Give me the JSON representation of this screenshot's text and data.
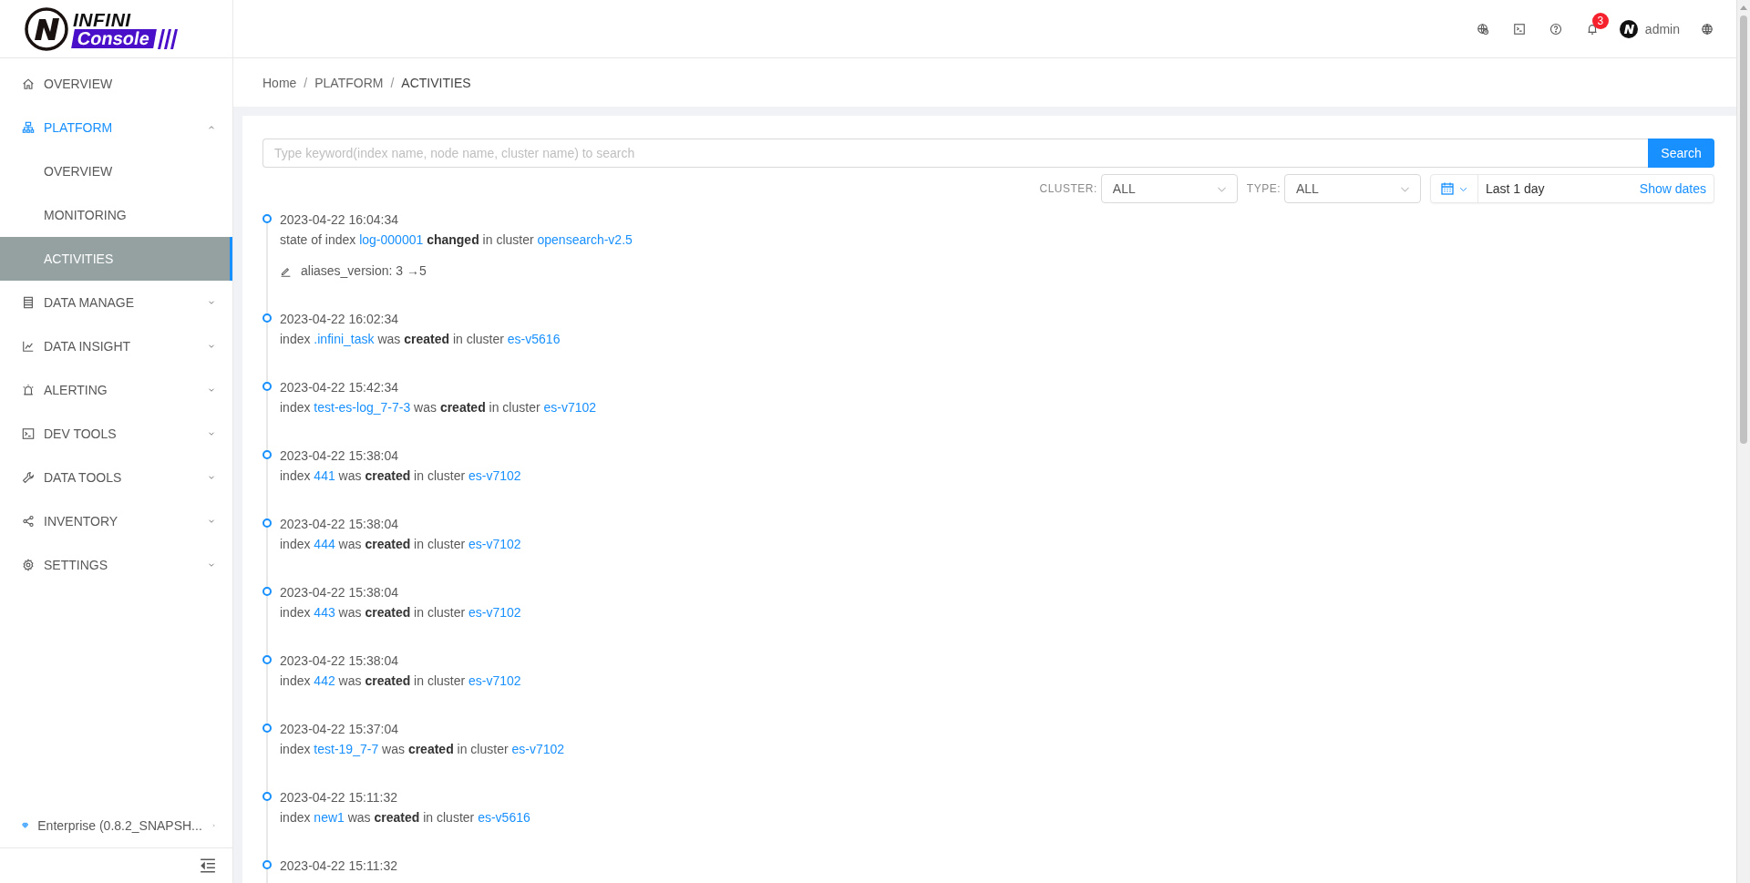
{
  "logo": {
    "top": "INFINI",
    "bottom": "Console"
  },
  "header": {
    "notifications": "3",
    "user": "admin"
  },
  "sidebar": {
    "items": [
      {
        "label": "OVERVIEW"
      },
      {
        "label": "PLATFORM",
        "expanded": true,
        "children": [
          {
            "label": "OVERVIEW",
            "selected": false
          },
          {
            "label": "MONITORING",
            "selected": false
          },
          {
            "label": "ACTIVITIES",
            "selected": true
          }
        ]
      },
      {
        "label": "DATA MANAGE",
        "expanded": false
      },
      {
        "label": "DATA INSIGHT",
        "expanded": false
      },
      {
        "label": "ALERTING",
        "expanded": false
      },
      {
        "label": "DEV TOOLS",
        "expanded": false
      },
      {
        "label": "DATA TOOLS",
        "expanded": false
      },
      {
        "label": "INVENTORY",
        "expanded": false
      },
      {
        "label": "SETTINGS",
        "expanded": false
      }
    ],
    "edition": "Enterprise (0.8.2_SNAPSH..."
  },
  "breadcrumb": [
    {
      "label": "Home",
      "separator": "/"
    },
    {
      "label": "PLATFORM",
      "separator": "/"
    },
    {
      "label": "ACTIVITIES"
    }
  ],
  "search": {
    "placeholder": "Type keyword(index name, node name, cluster name) to search",
    "button": "Search"
  },
  "filters": {
    "cluster": {
      "label": "CLUSTER:",
      "value": "ALL"
    },
    "type": {
      "label": "TYPE:",
      "value": "ALL"
    },
    "range": {
      "value": "Last 1 day",
      "toggle": "Show dates"
    }
  },
  "activities": [
    {
      "time": "2023-04-22 16:04:34",
      "message": [
        {
          "kind": "text",
          "text": "state of index "
        },
        {
          "kind": "link",
          "text": "log-000001"
        },
        {
          "kind": "text",
          "text": " **changed** in cluster "
        },
        {
          "kind": "link",
          "text": "opensearch-v2.5"
        }
      ],
      "changes": [
        "aliases_version: 3 →5"
      ]
    },
    {
      "time": "2023-04-22 16:02:34",
      "message": [
        {
          "kind": "text",
          "text": "index "
        },
        {
          "kind": "link",
          "text": ".infini_task"
        },
        {
          "kind": "text",
          "text": " was **created** in cluster "
        },
        {
          "kind": "link",
          "text": "es-v5616"
        }
      ]
    },
    {
      "time": "2023-04-22 15:42:34",
      "message": [
        {
          "kind": "text",
          "text": "index "
        },
        {
          "kind": "link",
          "text": "test-es-log_7-7-3"
        },
        {
          "kind": "text",
          "text": " was **created** in cluster "
        },
        {
          "kind": "link",
          "text": "es-v7102"
        }
      ]
    },
    {
      "time": "2023-04-22 15:38:04",
      "message": [
        {
          "kind": "text",
          "text": "index "
        },
        {
          "kind": "link",
          "text": "441"
        },
        {
          "kind": "text",
          "text": " was **created** in cluster "
        },
        {
          "kind": "link",
          "text": "es-v7102"
        }
      ]
    },
    {
      "time": "2023-04-22 15:38:04",
      "message": [
        {
          "kind": "text",
          "text": "index "
        },
        {
          "kind": "link",
          "text": "444"
        },
        {
          "kind": "text",
          "text": " was **created** in cluster "
        },
        {
          "kind": "link",
          "text": "es-v7102"
        }
      ]
    },
    {
      "time": "2023-04-22 15:38:04",
      "message": [
        {
          "kind": "text",
          "text": "index "
        },
        {
          "kind": "link",
          "text": "443"
        },
        {
          "kind": "text",
          "text": " was **created** in cluster "
        },
        {
          "kind": "link",
          "text": "es-v7102"
        }
      ]
    },
    {
      "time": "2023-04-22 15:38:04",
      "message": [
        {
          "kind": "text",
          "text": "index "
        },
        {
          "kind": "link",
          "text": "442"
        },
        {
          "kind": "text",
          "text": " was **created** in cluster "
        },
        {
          "kind": "link",
          "text": "es-v7102"
        }
      ]
    },
    {
      "time": "2023-04-22 15:37:04",
      "message": [
        {
          "kind": "text",
          "text": "index "
        },
        {
          "kind": "link",
          "text": "test-19_7-7"
        },
        {
          "kind": "text",
          "text": " was **created** in cluster "
        },
        {
          "kind": "link",
          "text": "es-v7102"
        }
      ]
    },
    {
      "time": "2023-04-22 15:11:32",
      "message": [
        {
          "kind": "text",
          "text": "index "
        },
        {
          "kind": "link",
          "text": "new1"
        },
        {
          "kind": "text",
          "text": " was **created** in cluster "
        },
        {
          "kind": "link",
          "text": "es-v5616"
        }
      ]
    },
    {
      "time": "2023-04-22 15:11:32"
    }
  ]
}
